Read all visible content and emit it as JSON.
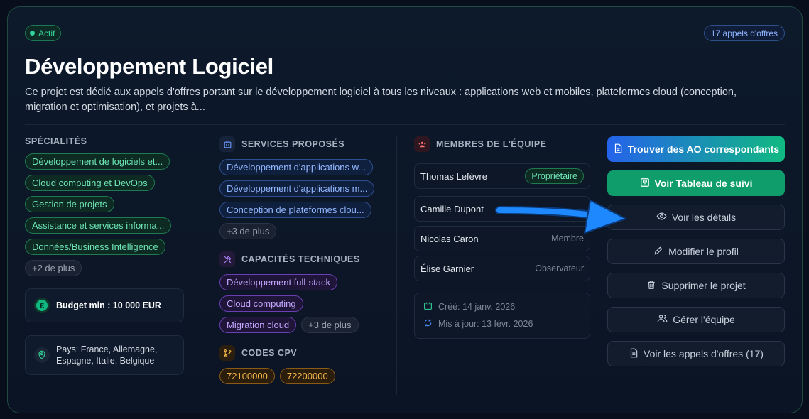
{
  "status_badge": "Actif",
  "count_badge": "17 appels d'offres",
  "title": "Développement Logiciel",
  "description": "Ce projet est dédié aux appels d'offres portant sur le développement logiciel à tous les niveaux : applications web et mobiles, plateformes cloud (conception, migration et optimisation), et projets à...",
  "specialites": {
    "label": "SPÉCIALITÉS",
    "items": [
      "Développement de logiciels et...",
      "Cloud computing et DevOps",
      "Gestion de projets",
      "Assistance et services informa...",
      "Données/Business Intelligence"
    ],
    "more": "+2 de plus"
  },
  "budget": "Budget min : 10 000 EUR",
  "pays": "Pays: France, Allemagne, Espagne, Italie, Belgique",
  "services": {
    "label": "SERVICES PROPOSÉS",
    "items": [
      "Développement d'applications w...",
      "Développement d'applications m...",
      "Conception de plateformes clou..."
    ],
    "more": "+3 de plus"
  },
  "capacites": {
    "label": "CAPACITÉS TECHNIQUES",
    "items": [
      "Développement full-stack",
      "Cloud computing",
      "Migration cloud"
    ],
    "more": "+3 de plus"
  },
  "cpv": {
    "label": "CODES CPV",
    "items": [
      "72100000",
      "72200000"
    ]
  },
  "equipe": {
    "label": "MEMBRES DE L'ÉQUIPE",
    "members": [
      {
        "name": "Thomas Lefèvre",
        "role": "Propriétaire"
      },
      {
        "name": "Camille Dupont",
        "role": ""
      },
      {
        "name": "Nicolas Caron",
        "role": "Membre"
      },
      {
        "name": "Élise Garnier",
        "role": "Observateur"
      }
    ],
    "created": "Créé: 14 janv. 2026",
    "updated": "Mis à jour: 13 févr. 2026"
  },
  "actions": {
    "find": "Trouver des AO correspondants",
    "board": "Voir Tableau de suivi",
    "details": "Voir les détails",
    "edit": "Modifier le profil",
    "delete": "Supprimer le projet",
    "team": "Gérer l'équipe",
    "tenders": "Voir les appels d'offres (17)"
  },
  "colors": {
    "accent_green": "#10b981",
    "accent_blue": "#2563eb",
    "arrow": "#1e88ff"
  }
}
